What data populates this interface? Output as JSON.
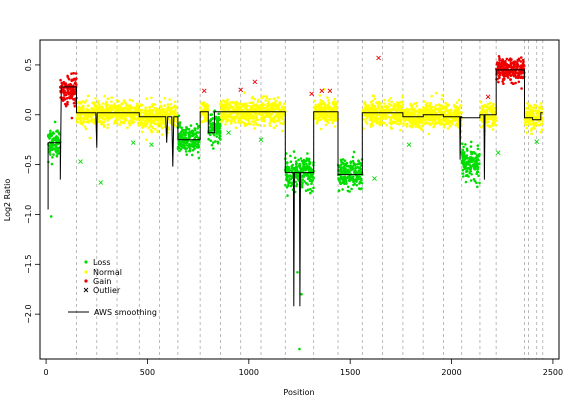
{
  "chart_data": {
    "type": "scatter",
    "xlabel": "Position",
    "ylabel": "Log2 Ratio",
    "xlim": [
      -30,
      2530
    ],
    "ylim": [
      -2.45,
      0.75
    ],
    "xticks": [
      0,
      500,
      1000,
      1500,
      2000,
      2500
    ],
    "yticks": [
      -2.0,
      -1.5,
      -1.0,
      -0.5,
      0.0,
      0.5
    ],
    "xtick_labels": [
      "0",
      "500",
      "1000",
      "1500",
      "2000",
      "2500"
    ],
    "ytick_labels": [
      "−2.0",
      "−1.5",
      "−1.0",
      "−0.5",
      "0.0",
      "0.5"
    ],
    "boundaries": [
      150,
      250,
      350,
      460,
      560,
      650,
      760,
      860,
      960,
      1060,
      1180,
      1320,
      1440,
      1560,
      1660,
      1760,
      1860,
      1960,
      2050,
      2140,
      2220,
      2360,
      2380,
      2420,
      2450
    ],
    "colors": {
      "loss": "#00dd00",
      "normal": "#ffff00",
      "gain": "#ee0000",
      "outlier": "#00dd00",
      "smooth": "#000000"
    },
    "segments": [
      {
        "class": "loss",
        "x0": 10,
        "x1": 70,
        "mean": -0.28,
        "sd": 0.07
      },
      {
        "class": "gain",
        "x0": 70,
        "x1": 150,
        "mean": 0.25,
        "sd": 0.07
      },
      {
        "class": "normal",
        "x0": 150,
        "x1": 250,
        "mean": 0.02,
        "sd": 0.06
      },
      {
        "class": "normal",
        "x0": 250,
        "x1": 350,
        "mean": 0.02,
        "sd": 0.06
      },
      {
        "class": "normal",
        "x0": 350,
        "x1": 460,
        "mean": 0.02,
        "sd": 0.06
      },
      {
        "class": "normal",
        "x0": 460,
        "x1": 560,
        "mean": -0.02,
        "sd": 0.06
      },
      {
        "class": "normal",
        "x0": 560,
        "x1": 650,
        "mean": -0.02,
        "sd": 0.06
      },
      {
        "class": "loss",
        "x0": 650,
        "x1": 760,
        "mean": -0.25,
        "sd": 0.07
      },
      {
        "class": "normal",
        "x0": 760,
        "x1": 800,
        "mean": 0.03,
        "sd": 0.06
      },
      {
        "class": "loss",
        "x0": 800,
        "x1": 860,
        "mean": -0.12,
        "sd": 0.07
      },
      {
        "class": "normal",
        "x0": 860,
        "x1": 960,
        "mean": 0.03,
        "sd": 0.06
      },
      {
        "class": "normal",
        "x0": 960,
        "x1": 1060,
        "mean": 0.03,
        "sd": 0.06
      },
      {
        "class": "normal",
        "x0": 1060,
        "x1": 1180,
        "mean": 0.03,
        "sd": 0.06
      },
      {
        "class": "loss",
        "x0": 1180,
        "x1": 1320,
        "mean": -0.58,
        "sd": 0.08
      },
      {
        "class": "normal",
        "x0": 1320,
        "x1": 1440,
        "mean": 0.03,
        "sd": 0.06
      },
      {
        "class": "loss",
        "x0": 1440,
        "x1": 1560,
        "mean": -0.6,
        "sd": 0.08
      },
      {
        "class": "normal",
        "x0": 1560,
        "x1": 1660,
        "mean": 0.02,
        "sd": 0.06
      },
      {
        "class": "normal",
        "x0": 1660,
        "x1": 1760,
        "mean": 0.02,
        "sd": 0.06
      },
      {
        "class": "normal",
        "x0": 1760,
        "x1": 1860,
        "mean": -0.02,
        "sd": 0.06
      },
      {
        "class": "normal",
        "x0": 1860,
        "x1": 1960,
        "mean": 0.0,
        "sd": 0.06
      },
      {
        "class": "normal",
        "x0": 1960,
        "x1": 2050,
        "mean": -0.02,
        "sd": 0.06
      },
      {
        "class": "loss",
        "x0": 2050,
        "x1": 2140,
        "mean": -0.48,
        "sd": 0.08
      },
      {
        "class": "normal",
        "x0": 2140,
        "x1": 2220,
        "mean": 0.0,
        "sd": 0.06
      },
      {
        "class": "gain",
        "x0": 2220,
        "x1": 2360,
        "mean": 0.45,
        "sd": 0.06
      },
      {
        "class": "normal",
        "x0": 2360,
        "x1": 2450,
        "mean": -0.03,
        "sd": 0.06
      }
    ],
    "smoothing": [
      [
        10,
        -0.95
      ],
      [
        10,
        -0.28
      ],
      [
        70,
        -0.28
      ],
      [
        70,
        -0.65
      ],
      [
        72,
        -0.28
      ],
      [
        75,
        0.28
      ],
      [
        150,
        0.28
      ],
      [
        150,
        0.02
      ],
      [
        245,
        0.02
      ],
      [
        250,
        -0.33
      ],
      [
        252,
        0.02
      ],
      [
        460,
        0.02
      ],
      [
        460,
        -0.02
      ],
      [
        590,
        -0.02
      ],
      [
        595,
        -0.28
      ],
      [
        600,
        -0.02
      ],
      [
        620,
        -0.02
      ],
      [
        625,
        -0.52
      ],
      [
        630,
        -0.02
      ],
      [
        650,
        -0.02
      ],
      [
        650,
        -0.25
      ],
      [
        760,
        -0.25
      ],
      [
        760,
        0.03
      ],
      [
        800,
        0.03
      ],
      [
        800,
        -0.18
      ],
      [
        830,
        -0.18
      ],
      [
        830,
        0.03
      ],
      [
        1180,
        0.03
      ],
      [
        1180,
        -0.58
      ],
      [
        1220,
        -0.58
      ],
      [
        1222,
        -1.92
      ],
      [
        1225,
        -0.58
      ],
      [
        1250,
        -0.58
      ],
      [
        1252,
        -1.92
      ],
      [
        1255,
        -0.58
      ],
      [
        1320,
        -0.58
      ],
      [
        1320,
        0.03
      ],
      [
        1440,
        0.03
      ],
      [
        1440,
        -0.6
      ],
      [
        1560,
        -0.6
      ],
      [
        1560,
        0.02
      ],
      [
        1760,
        0.02
      ],
      [
        1760,
        -0.02
      ],
      [
        1860,
        -0.02
      ],
      [
        1860,
        0.0
      ],
      [
        1960,
        0.0
      ],
      [
        1960,
        -0.02
      ],
      [
        2040,
        -0.02
      ],
      [
        2042,
        -0.45
      ],
      [
        2045,
        -0.02
      ],
      [
        2050,
        -0.02
      ],
      [
        2050,
        -0.03
      ],
      [
        2140,
        -0.03
      ],
      [
        2140,
        0.0
      ],
      [
        2160,
        0.0
      ],
      [
        2162,
        -0.65
      ],
      [
        2165,
        0.0
      ],
      [
        2220,
        0.0
      ],
      [
        2220,
        0.45
      ],
      [
        2360,
        0.45
      ],
      [
        2360,
        -0.03
      ],
      [
        2400,
        -0.03
      ],
      [
        2400,
        -0.05
      ],
      [
        2440,
        -0.05
      ],
      [
        2440,
        0.02
      ],
      [
        2450,
        0.02
      ]
    ],
    "loss_extremes": [
      [
        1250,
        -2.35
      ],
      [
        1240,
        -1.58
      ],
      [
        1260,
        -1.8
      ],
      [
        25,
        -1.02
      ]
    ],
    "outliers": [
      {
        "x": 1640,
        "y": 0.57,
        "color": "#ee0000"
      },
      {
        "x": 1310,
        "y": 0.21,
        "color": "#ee0000"
      },
      {
        "x": 1360,
        "y": 0.24,
        "color": "#ee0000"
      },
      {
        "x": 1400,
        "y": 0.24,
        "color": "#ee0000"
      },
      {
        "x": 1030,
        "y": 0.33,
        "color": "#ee0000"
      },
      {
        "x": 780,
        "y": 0.24,
        "color": "#ee0000"
      },
      {
        "x": 960,
        "y": 0.25,
        "color": "#ee0000"
      },
      {
        "x": 2180,
        "y": 0.18,
        "color": "#ee0000"
      },
      {
        "x": 170,
        "y": -0.47,
        "color": "#00dd00"
      },
      {
        "x": 270,
        "y": -0.68,
        "color": "#00dd00"
      },
      {
        "x": 430,
        "y": -0.28,
        "color": "#00dd00"
      },
      {
        "x": 520,
        "y": -0.3,
        "color": "#00dd00"
      },
      {
        "x": 900,
        "y": -0.18,
        "color": "#00dd00"
      },
      {
        "x": 1060,
        "y": -0.25,
        "color": "#00dd00"
      },
      {
        "x": 1620,
        "y": -0.64,
        "color": "#00dd00"
      },
      {
        "x": 1790,
        "y": -0.3,
        "color": "#00dd00"
      },
      {
        "x": 2230,
        "y": -0.38,
        "color": "#00dd00"
      },
      {
        "x": 2420,
        "y": -0.27,
        "color": "#00dd00"
      }
    ],
    "legend": {
      "placement": "bottom-left",
      "items": [
        {
          "label": "Loss",
          "kind": "point",
          "color": "#00dd00"
        },
        {
          "label": "Normal",
          "kind": "point",
          "color": "#ffff00"
        },
        {
          "label": "Gain",
          "kind": "point",
          "color": "#ee0000"
        },
        {
          "label": "Outlier",
          "kind": "cross",
          "color": "#000000"
        },
        {
          "label": "AWS smoothing",
          "kind": "line",
          "color": "#000000"
        }
      ]
    }
  }
}
